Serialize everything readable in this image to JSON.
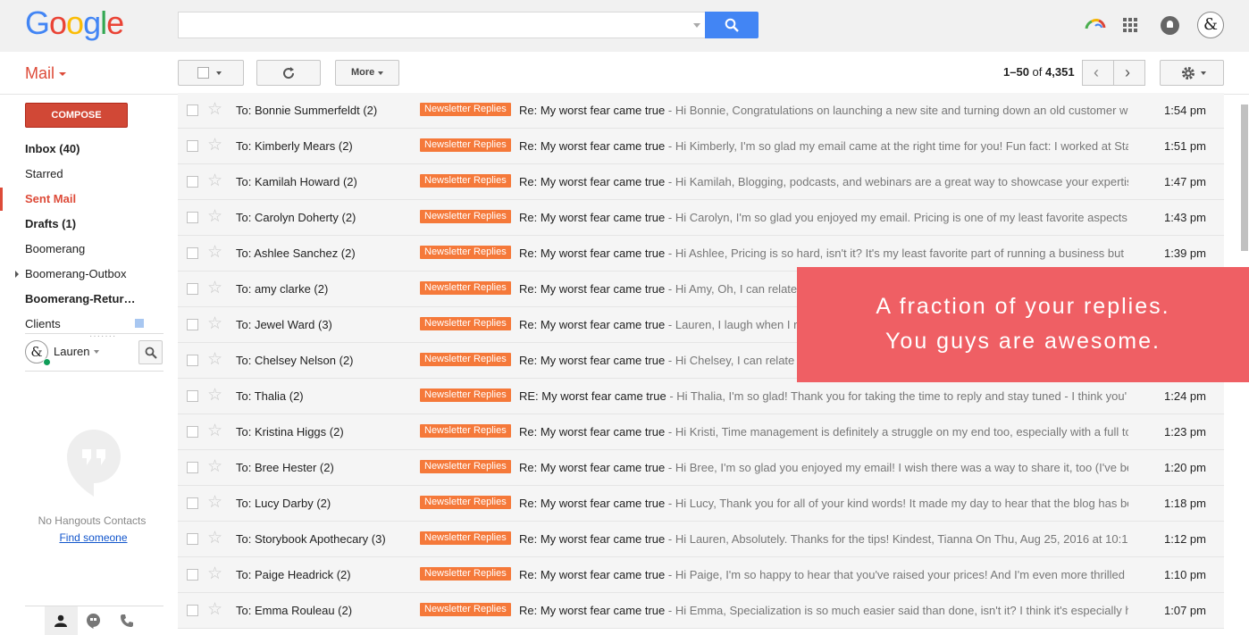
{
  "brand": {
    "logo_letters": [
      "G",
      "o",
      "o",
      "g",
      "l",
      "e"
    ],
    "logo_colors": [
      "#4285f4",
      "#ea4335",
      "#fbbc05",
      "#4285f4",
      "#34a853",
      "#ea4335"
    ],
    "accent": "#dd4b39",
    "label_color": "#f5793a",
    "banner_color": "#ef5f64"
  },
  "header": {
    "search": {
      "value": "",
      "placeholder": ""
    },
    "icons": [
      "search-icon",
      "apps-grid-icon",
      "notifications-icon",
      "account-avatar-icon"
    ]
  },
  "toolbar": {
    "mail_label": "Mail",
    "more_label": "More",
    "pager_range": "1–50",
    "pager_of": "of",
    "pager_total": "4,351"
  },
  "sidebar": {
    "compose_label": "COMPOSE",
    "items": [
      {
        "label": "Inbox (40)",
        "style": "bold"
      },
      {
        "label": "Starred",
        "style": "normal"
      },
      {
        "label": "Sent Mail",
        "style": "active"
      },
      {
        "label": "Drafts (1)",
        "style": "bold"
      },
      {
        "label": "Boomerang",
        "style": "normal"
      },
      {
        "label": "Boomerang-Outbox",
        "style": "normal"
      },
      {
        "label": "Boomerang-Retur…",
        "style": "bold"
      },
      {
        "label": "Clients",
        "style": "normal"
      }
    ],
    "user_name": "Lauren",
    "hangouts_empty": "No Hangouts Contacts",
    "find_someone": "Find someone"
  },
  "emails": [
    {
      "sender": "To: Bonnie Summerfeldt (2)",
      "label": "Newsletter Replies",
      "subject": "Re: My worst fear came true",
      "snippet": " - Hi Bonnie, Congratulations on launching a new site and turning down an old customer w",
      "time": "1:54 pm"
    },
    {
      "sender": "To: Kimberly Mears (2)",
      "label": "Newsletter Replies",
      "subject": "Re: My worst fear came true",
      "snippet": " - Hi Kimberly, I'm so glad my email came at the right time for you! Fun fact: I worked at Sta",
      "time": "1:51 pm"
    },
    {
      "sender": "To: Kamilah Howard (2)",
      "label": "Newsletter Replies",
      "subject": "Re: My worst fear came true",
      "snippet": " - Hi Kamilah, Blogging, podcasts, and webinars are a great way to showcase your expertis",
      "time": "1:47 pm"
    },
    {
      "sender": "To: Carolyn Doherty (2)",
      "label": "Newsletter Replies",
      "subject": "Re: My worst fear came true",
      "snippet": " - Hi Carolyn, I'm so glad you enjoyed my email. Pricing is one of my least favorite aspects",
      "time": "1:43 pm"
    },
    {
      "sender": "To: Ashlee Sanchez (2)",
      "label": "Newsletter Replies",
      "subject": "Re: My worst fear came true",
      "snippet": " - Hi Ashlee, Pricing is so hard, isn't it? It's my least favorite part of running a business but",
      "time": "1:39 pm"
    },
    {
      "sender": "To: amy clarke (2)",
      "label": "Newsletter Replies",
      "subject": "Re: My worst fear came true",
      "snippet": " - Hi Amy, Oh, I can relate",
      "time": ""
    },
    {
      "sender": "To: Jewel Ward (3)",
      "label": "Newsletter Replies",
      "subject": "Re: My worst fear came true",
      "snippet": " - Lauren, I laugh when I r",
      "time": ""
    },
    {
      "sender": "To: Chelsey Nelson (2)",
      "label": "Newsletter Replies",
      "subject": "Re: My worst fear came true",
      "snippet": " - Hi Chelsey, I can relate",
      "time": ""
    },
    {
      "sender": "To: Thalia (2)",
      "label": "Newsletter Replies",
      "subject": "RE: My worst fear came true",
      "snippet": " - Hi Thalia, I'm so glad! Thank you for taking the time to reply and stay tuned - I think you'",
      "time": "1:24 pm"
    },
    {
      "sender": "To: Kristina Higgs (2)",
      "label": "Newsletter Replies",
      "subject": "Re: My worst fear came true",
      "snippet": " - Hi Kristi, Time management is definitely a struggle on my end too, especially with a full tc",
      "time": "1:23 pm"
    },
    {
      "sender": "To: Bree Hester (2)",
      "label": "Newsletter Replies",
      "subject": "Re: My worst fear came true",
      "snippet": " - Hi Bree, I'm so glad you enjoyed my email! I wish there was a way to share it, too (I've be",
      "time": "1:20 pm"
    },
    {
      "sender": "To: Lucy Darby (2)",
      "label": "Newsletter Replies",
      "subject": "Re: My worst fear came true",
      "snippet": " - Hi Lucy, Thank you for all of your kind words! It made my day to hear that the blog has be",
      "time": "1:18 pm"
    },
    {
      "sender": "To: Storybook Apothecary (3)",
      "label": "Newsletter Replies",
      "subject": "Re: My worst fear came true",
      "snippet": " - Hi Lauren, Absolutely. Thanks for the tips! Kindest, Tianna On Thu, Aug 25, 2016 at 10:1",
      "time": "1:12 pm"
    },
    {
      "sender": "To: Paige Headrick (2)",
      "label": "Newsletter Replies",
      "subject": "Re: My worst fear came true",
      "snippet": " - Hi Paige, I'm so happy to hear that you've raised your prices! And I'm even more thrilled",
      "time": "1:10 pm"
    },
    {
      "sender": "To: Emma Rouleau (2)",
      "label": "Newsletter Replies",
      "subject": "Re: My worst fear came true",
      "snippet": " - Hi Emma, Specialization is so much easier said than done, isn't it? I think it's especially h",
      "time": "1:07 pm"
    }
  ],
  "banner": {
    "line1": "A fraction of your replies.",
    "line2": "You guys are awesome."
  }
}
